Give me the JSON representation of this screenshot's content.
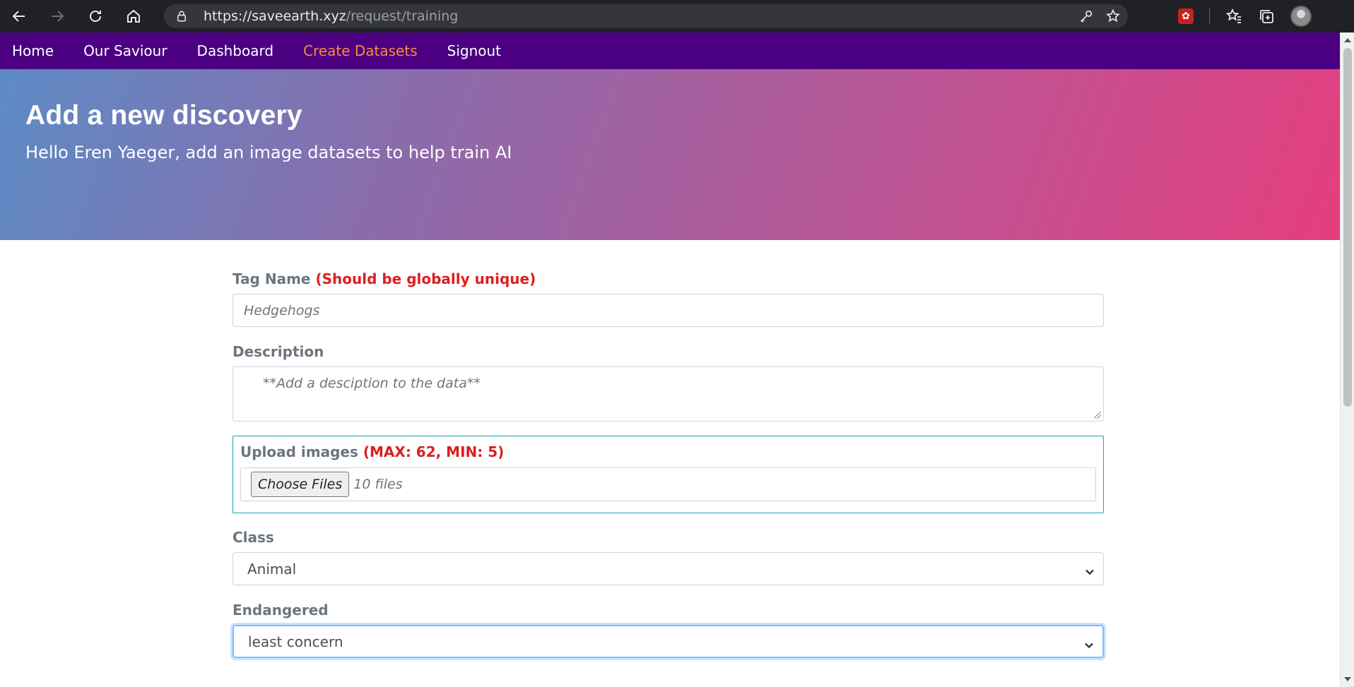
{
  "browser": {
    "url_main": "https://saveearth.xyz",
    "url_path": "/request/training"
  },
  "nav": {
    "items": [
      {
        "label": "Home"
      },
      {
        "label": "Our Saviour"
      },
      {
        "label": "Dashboard"
      },
      {
        "label": "Create Datasets",
        "active": true
      },
      {
        "label": "Signout"
      }
    ]
  },
  "hero": {
    "title": "Add a new discovery",
    "subtitle": "Hello Eren Yaeger, add an image datasets to help train AI"
  },
  "form": {
    "tag_name": {
      "label": "Tag Name",
      "note": "(Should be globally unique)",
      "value": "Hedgehogs"
    },
    "description": {
      "label": "Description",
      "placeholder": "**Add a desciption to the data**"
    },
    "upload": {
      "label": "Upload images",
      "note": "(MAX: 62, MIN: 5)",
      "button": "Choose Files",
      "status": "10 files"
    },
    "class": {
      "label": "Class",
      "selected": "Animal"
    },
    "endangered": {
      "label": "Endangered",
      "selected": "least concern"
    }
  },
  "colors": {
    "nav_bg": "#4b0082",
    "nav_active": "#ff8a3d",
    "warning": "#dc1f1f",
    "upload_border": "#17a2b8"
  },
  "icons": [
    "back-icon",
    "forward-icon",
    "refresh-icon",
    "home-icon",
    "lock-icon",
    "key-icon",
    "add-favorite-icon",
    "extension-icon",
    "favorites-icon",
    "collections-icon",
    "profile-avatar",
    "more-icon",
    "chevron-down-icon"
  ]
}
